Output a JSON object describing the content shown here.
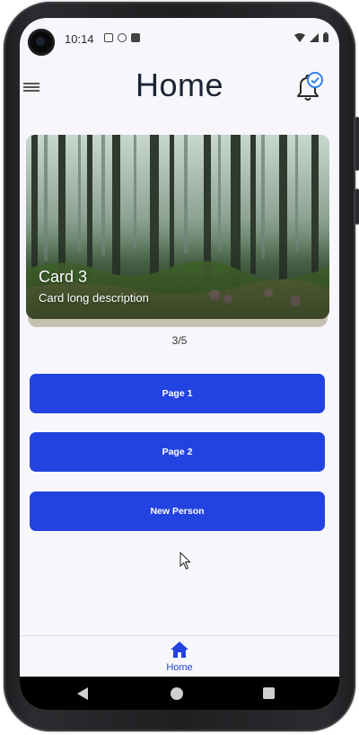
{
  "status_bar": {
    "time": "10:14"
  },
  "header": {
    "title": "Home",
    "menu_icon": "hamburger-menu-icon",
    "notification_icon": "bell-icon",
    "notification_badge_icon": "check-circle-icon"
  },
  "carousel": {
    "card": {
      "title": "Card 3",
      "description": "Card long description",
      "image": "forest-image"
    },
    "indicator": "3/5"
  },
  "buttons": [
    {
      "label": "Page 1"
    },
    {
      "label": "Page 2"
    },
    {
      "label": "New Person"
    }
  ],
  "bottom_nav": {
    "items": [
      {
        "label": "Home",
        "icon": "home-icon",
        "active": true
      }
    ]
  },
  "colors": {
    "primary": "#2343e0",
    "title": "#1c2433",
    "background": "#f7f7fb",
    "badge": "#2f80ed"
  }
}
